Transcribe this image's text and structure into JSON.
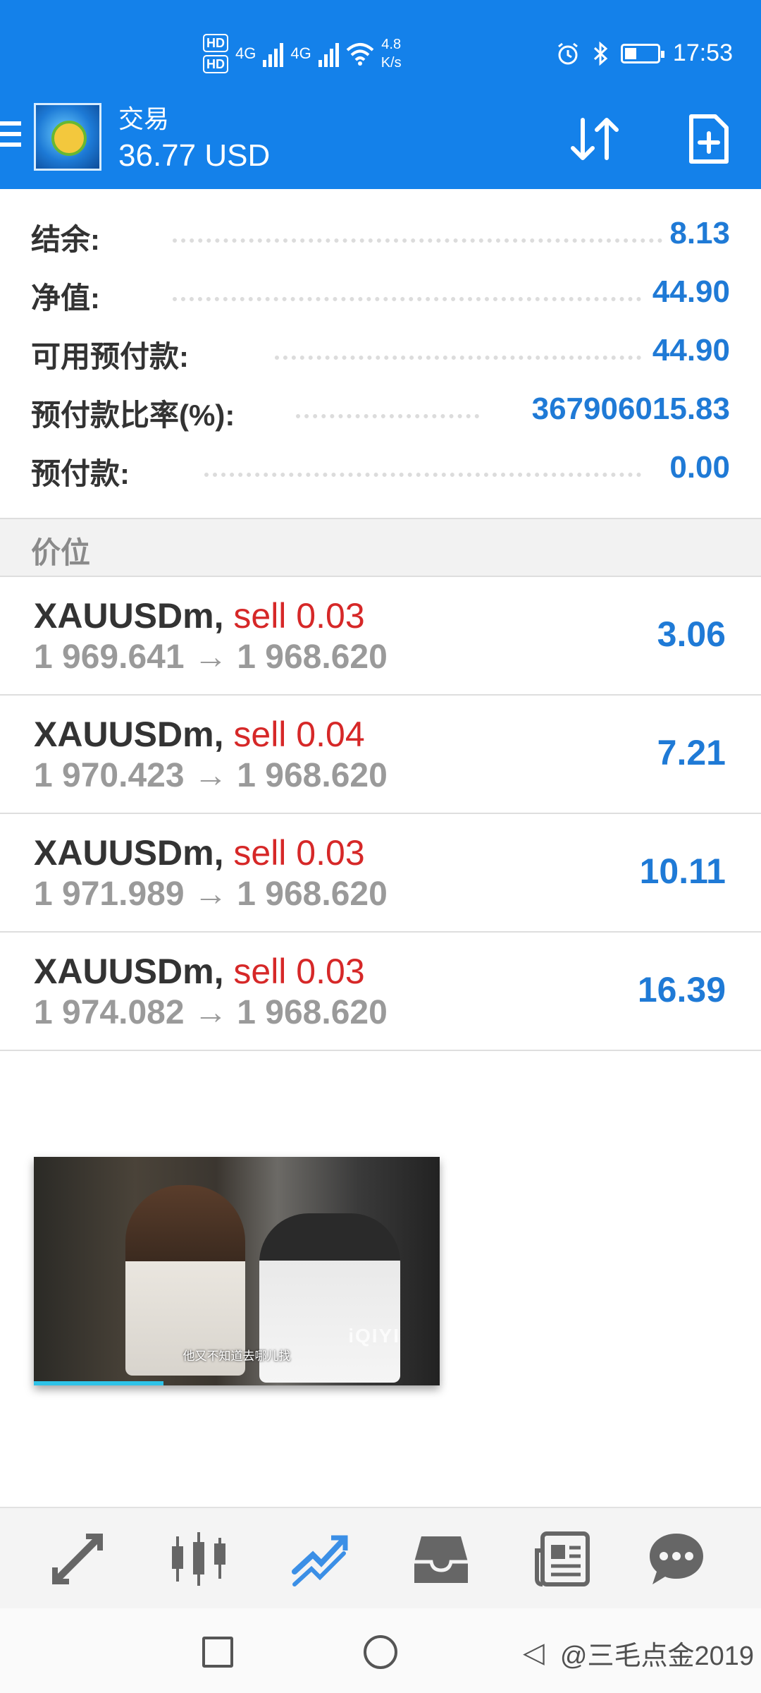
{
  "status_bar": {
    "hd1": "HD",
    "hd2": "HD",
    "net1": "4G",
    "net2": "4G",
    "speed_value": "4.8",
    "speed_unit": "K/s",
    "time": "17:53"
  },
  "header": {
    "title": "交易",
    "balance": "36.77 USD",
    "accent_color": "#1481ea"
  },
  "account": [
    {
      "label": "结余:",
      "value": "8.13"
    },
    {
      "label": "净值:",
      "value": "44.90"
    },
    {
      "label": "可用预付款:",
      "value": "44.90"
    },
    {
      "label": "预付款比率(%):",
      "value": "367906015.83"
    },
    {
      "label": "预付款:",
      "value": "0.00"
    }
  ],
  "section_title": "价位",
  "positions": [
    {
      "symbol": "XAUUSDm,",
      "side": "sell 0.03",
      "open": "1 969.641",
      "arrow": "→",
      "current": "1 968.620",
      "profit": "3.06"
    },
    {
      "symbol": "XAUUSDm,",
      "side": "sell 0.04",
      "open": "1 970.423",
      "arrow": "→",
      "current": "1 968.620",
      "profit": "7.21"
    },
    {
      "symbol": "XAUUSDm,",
      "side": "sell 0.03",
      "open": "1 971.989",
      "arrow": "→",
      "current": "1 968.620",
      "profit": "10.11"
    },
    {
      "symbol": "XAUUSDm,",
      "side": "sell 0.03",
      "open": "1 974.082",
      "arrow": "→",
      "current": "1 968.620",
      "profit": "16.39"
    }
  ],
  "video": {
    "subtitle": "他又不知道去哪儿找",
    "watermark": "iQIYI",
    "progress": 0.32
  },
  "bottom_nav": [
    "quotes-icon",
    "chart-icon",
    "trade-icon",
    "history-icon",
    "news-icon",
    "chat-icon"
  ],
  "active_nav": "trade-icon",
  "system_watermark": "@三毛点金2019"
}
